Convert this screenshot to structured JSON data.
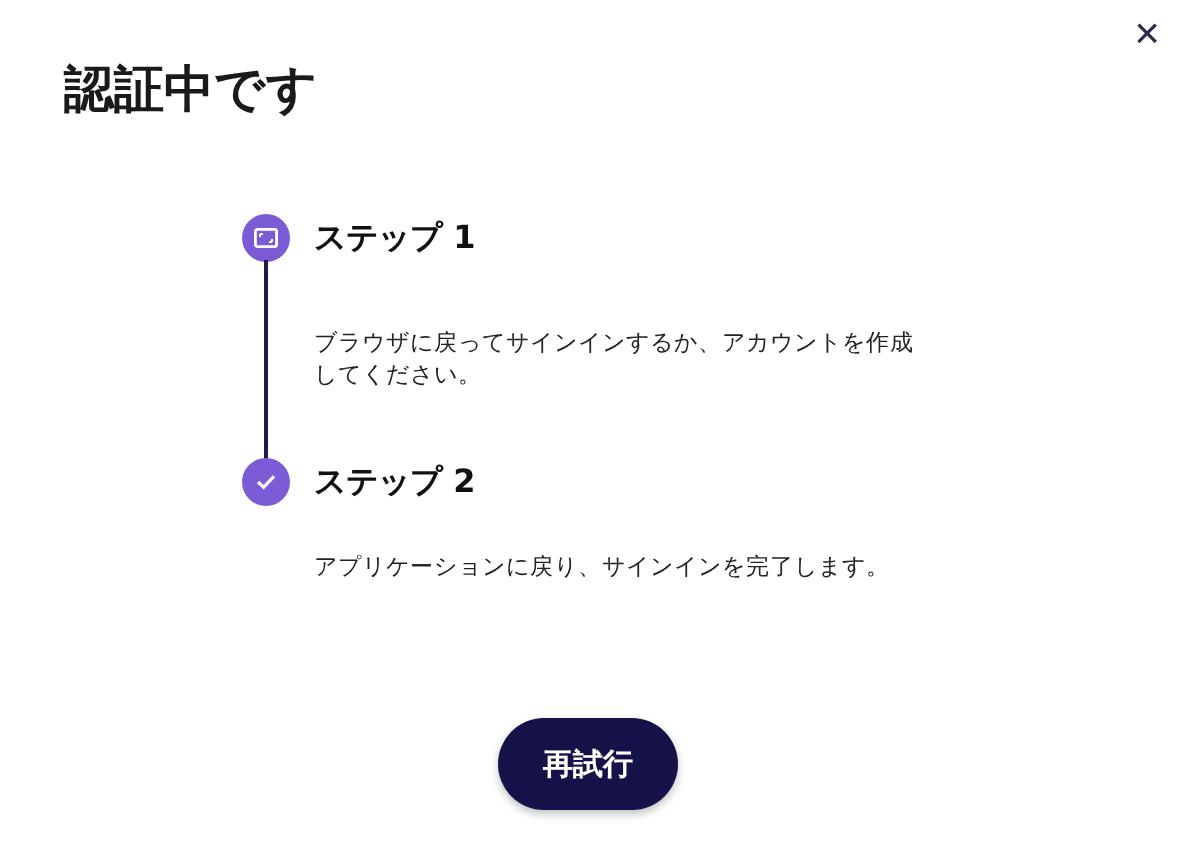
{
  "dialog": {
    "title": "認証中です",
    "close": "×"
  },
  "steps": [
    {
      "kind": "browser",
      "title": "ステップ 1",
      "description": "ブラウザに戻ってサインインするか、アカウントを作成してください。"
    },
    {
      "kind": "check",
      "title": "ステップ 2",
      "description": "アプリケーションに戻り、サインインを完了します。"
    }
  ],
  "buttons": [
    "再試行"
  ]
}
